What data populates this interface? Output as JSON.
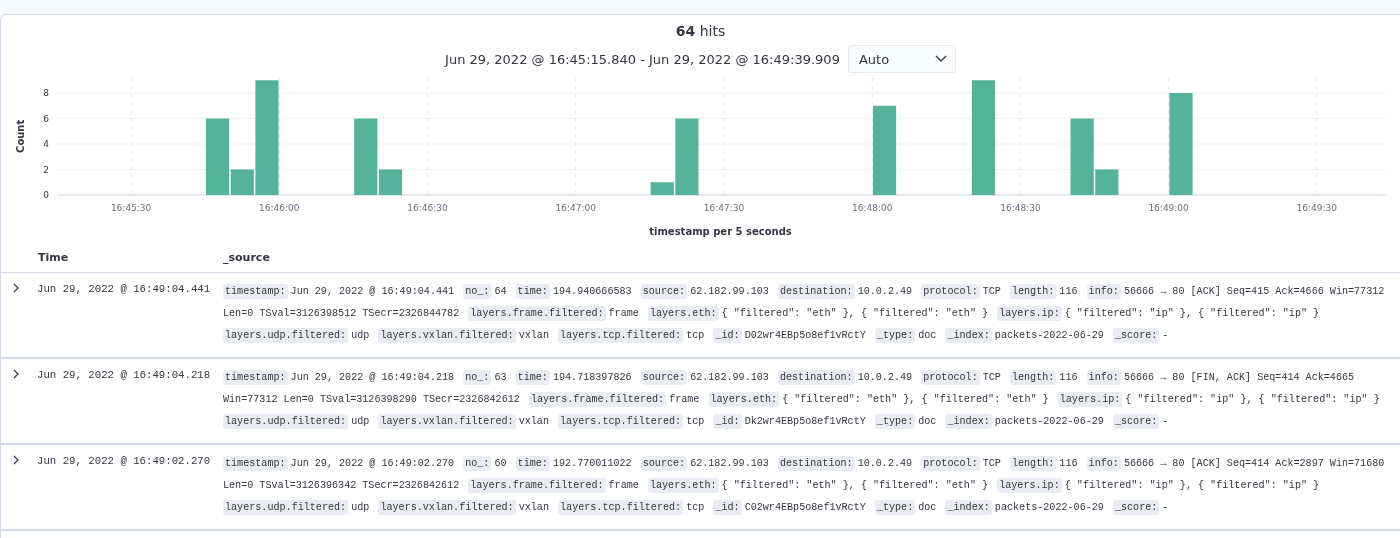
{
  "hits": {
    "count": "64",
    "label": "hits"
  },
  "range": {
    "text": "Jun 29, 2022 @ 16:45:15.840 - Jun 29, 2022 @ 16:49:39.909",
    "interval": "Auto"
  },
  "histogram": {
    "chart_data": {
      "type": "bar",
      "xlabel": "timestamp per 5 seconds",
      "ylabel": "Count",
      "ylim": [
        0,
        9.2
      ],
      "yticks": [
        0,
        2,
        4,
        6,
        8
      ],
      "grid": true,
      "xlim": [
        60315,
        60584
      ],
      "xticks": [
        {
          "value": 60330,
          "label": "16:45:30"
        },
        {
          "value": 60360,
          "label": "16:46:00"
        },
        {
          "value": 60390,
          "label": "16:46:30"
        },
        {
          "value": 60420,
          "label": "16:47:00"
        },
        {
          "value": 60450,
          "label": "16:47:30"
        },
        {
          "value": 60480,
          "label": "16:48:00"
        },
        {
          "value": 60510,
          "label": "16:48:30"
        },
        {
          "value": 60540,
          "label": "16:49:00"
        },
        {
          "value": 60570,
          "label": "16:49:30"
        }
      ],
      "x": [
        60347.5,
        60352.5,
        60357.5,
        60377.5,
        60382.5,
        60437.5,
        60442.5,
        60482.5,
        60502.5,
        60522.5,
        60527.5,
        60542.5
      ],
      "series": [
        {
          "color": "#54b399",
          "values": [
            6,
            2,
            9,
            6,
            2,
            1,
            6,
            7,
            9,
            6,
            2,
            8
          ]
        }
      ]
    }
  },
  "table": {
    "columns": [
      "Time",
      "_source"
    ],
    "rows": [
      {
        "expanded": false,
        "time": "Jun 29, 2022 @ 16:49:04.441",
        "fields": [
          {
            "key": "timestamp:",
            "value": "Jun 29, 2022 @ 16:49:04.441"
          },
          {
            "key": "no_:",
            "value": "64"
          },
          {
            "key": "time:",
            "value": "194.940666583"
          },
          {
            "key": "source:",
            "value": "62.182.99.103"
          },
          {
            "key": "destination:",
            "value": "10.0.2.49"
          },
          {
            "key": "protocol:",
            "value": "TCP"
          },
          {
            "key": "length:",
            "value": "116"
          },
          {
            "key": "info:",
            "value": "56666 → 80 [ACK] Seq=415 Ack=4666 Win=77312 Len=0 TSval=3126398512 TSecr=2326844782"
          },
          {
            "key": "layers.frame.filtered:",
            "value": "frame"
          },
          {
            "key": "layers.eth:",
            "value": "{ \"filtered\": \"eth\" }, { \"filtered\": \"eth\" }"
          },
          {
            "key": "layers.ip:",
            "value": "{ \"filtered\": \"ip\" }, { \"filtered\": \"ip\" }"
          },
          {
            "key": "layers.udp.filtered:",
            "value": "udp"
          },
          {
            "key": "layers.vxlan.filtered:",
            "value": "vxlan"
          },
          {
            "key": "layers.tcp.filtered:",
            "value": "tcp"
          },
          {
            "key": "_id:",
            "value": "D02wr4EBp5o8ef1vRctY"
          },
          {
            "key": "_type:",
            "value": "doc"
          },
          {
            "key": "_index:",
            "value": "packets-2022-06-29"
          },
          {
            "key": "_score:",
            "value": "-"
          }
        ]
      },
      {
        "expanded": false,
        "time": "Jun 29, 2022 @ 16:49:04.218",
        "fields": [
          {
            "key": "timestamp:",
            "value": "Jun 29, 2022 @ 16:49:04.218"
          },
          {
            "key": "no_:",
            "value": "63"
          },
          {
            "key": "time:",
            "value": "194.718397826"
          },
          {
            "key": "source:",
            "value": "62.182.99.103"
          },
          {
            "key": "destination:",
            "value": "10.0.2.49"
          },
          {
            "key": "protocol:",
            "value": "TCP"
          },
          {
            "key": "length:",
            "value": "116"
          },
          {
            "key": "info:",
            "value": "56666 → 80 [FIN, ACK] Seq=414 Ack=4665 Win=77312 Len=0 TSval=3126398290 TSecr=2326842612"
          },
          {
            "key": "layers.frame.filtered:",
            "value": "frame"
          },
          {
            "key": "layers.eth:",
            "value": "{ \"filtered\": \"eth\" }, { \"filtered\": \"eth\" }"
          },
          {
            "key": "layers.ip:",
            "value": "{ \"filtered\": \"ip\" }, { \"filtered\": \"ip\" }"
          },
          {
            "key": "layers.udp.filtered:",
            "value": "udp"
          },
          {
            "key": "layers.vxlan.filtered:",
            "value": "vxlan"
          },
          {
            "key": "layers.tcp.filtered:",
            "value": "tcp"
          },
          {
            "key": "_id:",
            "value": "Dk2wr4EBp5o8ef1vRctY"
          },
          {
            "key": "_type:",
            "value": "doc"
          },
          {
            "key": "_index:",
            "value": "packets-2022-06-29"
          },
          {
            "key": "_score:",
            "value": "-"
          }
        ]
      },
      {
        "expanded": false,
        "time": "Jun 29, 2022 @ 16:49:02.270",
        "fields": [
          {
            "key": "timestamp:",
            "value": "Jun 29, 2022 @ 16:49:02.270"
          },
          {
            "key": "no_:",
            "value": "60"
          },
          {
            "key": "time:",
            "value": "192.770011022"
          },
          {
            "key": "source:",
            "value": "62.182.99.103"
          },
          {
            "key": "destination:",
            "value": "10.0.2.49"
          },
          {
            "key": "protocol:",
            "value": "TCP"
          },
          {
            "key": "length:",
            "value": "116"
          },
          {
            "key": "info:",
            "value": "56666 → 80 [ACK] Seq=414 Ack=2897 Win=71680 Len=0 TSval=3126396342 TSecr=2326842612"
          },
          {
            "key": "layers.frame.filtered:",
            "value": "frame"
          },
          {
            "key": "layers.eth:",
            "value": "{ \"filtered\": \"eth\" }, { \"filtered\": \"eth\" }"
          },
          {
            "key": "layers.ip:",
            "value": "{ \"filtered\": \"ip\" }, { \"filtered\": \"ip\" }"
          },
          {
            "key": "layers.udp.filtered:",
            "value": "udp"
          },
          {
            "key": "layers.vxlan.filtered:",
            "value": "vxlan"
          },
          {
            "key": "layers.tcp.filtered:",
            "value": "tcp"
          },
          {
            "key": "_id:",
            "value": "C02wr4EBp5o8ef1vRctY"
          },
          {
            "key": "_type:",
            "value": "doc"
          },
          {
            "key": "_index:",
            "value": "packets-2022-06-29"
          },
          {
            "key": "_score:",
            "value": "-"
          }
        ]
      }
    ]
  }
}
